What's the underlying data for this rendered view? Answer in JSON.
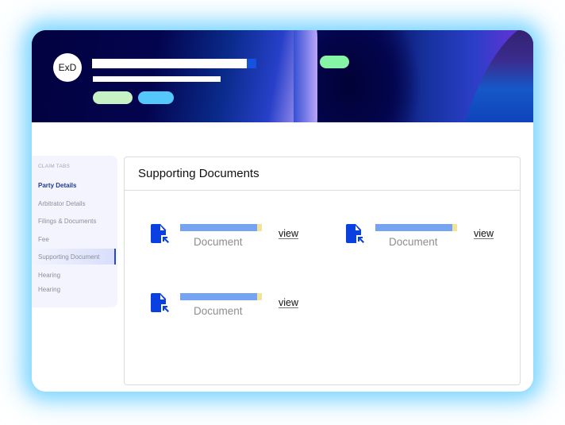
{
  "header": {
    "avatar_initials": "ExD",
    "colors": {
      "banner_dark": "#02023f",
      "name_accent": "#1652df",
      "pill_green_light": "#c6f2c4",
      "pill_blue": "#54c8fb",
      "pill_green": "#86f5a6"
    }
  },
  "sidebar": {
    "section_label": "CLAIM TABS",
    "items": [
      {
        "label": "Party Details",
        "state": "title"
      },
      {
        "label": "Arbitrator Details",
        "state": "normal"
      },
      {
        "label": "Filings & Documents",
        "state": "normal"
      },
      {
        "label": "Fee",
        "state": "normal"
      },
      {
        "label": "Supporting Document",
        "state": "selected"
      },
      {
        "label": "Hearing",
        "state": "normal"
      },
      {
        "label": "Hearing",
        "state": "normal"
      }
    ]
  },
  "main": {
    "title": "Supporting Documents",
    "documents": [
      {
        "label": "Document",
        "action": "view",
        "icon": "file-upload-icon",
        "progress": 0.94
      },
      {
        "label": "Document",
        "action": "view",
        "icon": "file-upload-icon",
        "progress": 0.94
      },
      {
        "label": "Document",
        "action": "view",
        "icon": "file-upload-icon",
        "progress": 0.94
      }
    ],
    "colors": {
      "icon": "#0a3fe0",
      "progress_fill": "#76a4f3",
      "progress_track": "#f1e29c"
    }
  }
}
